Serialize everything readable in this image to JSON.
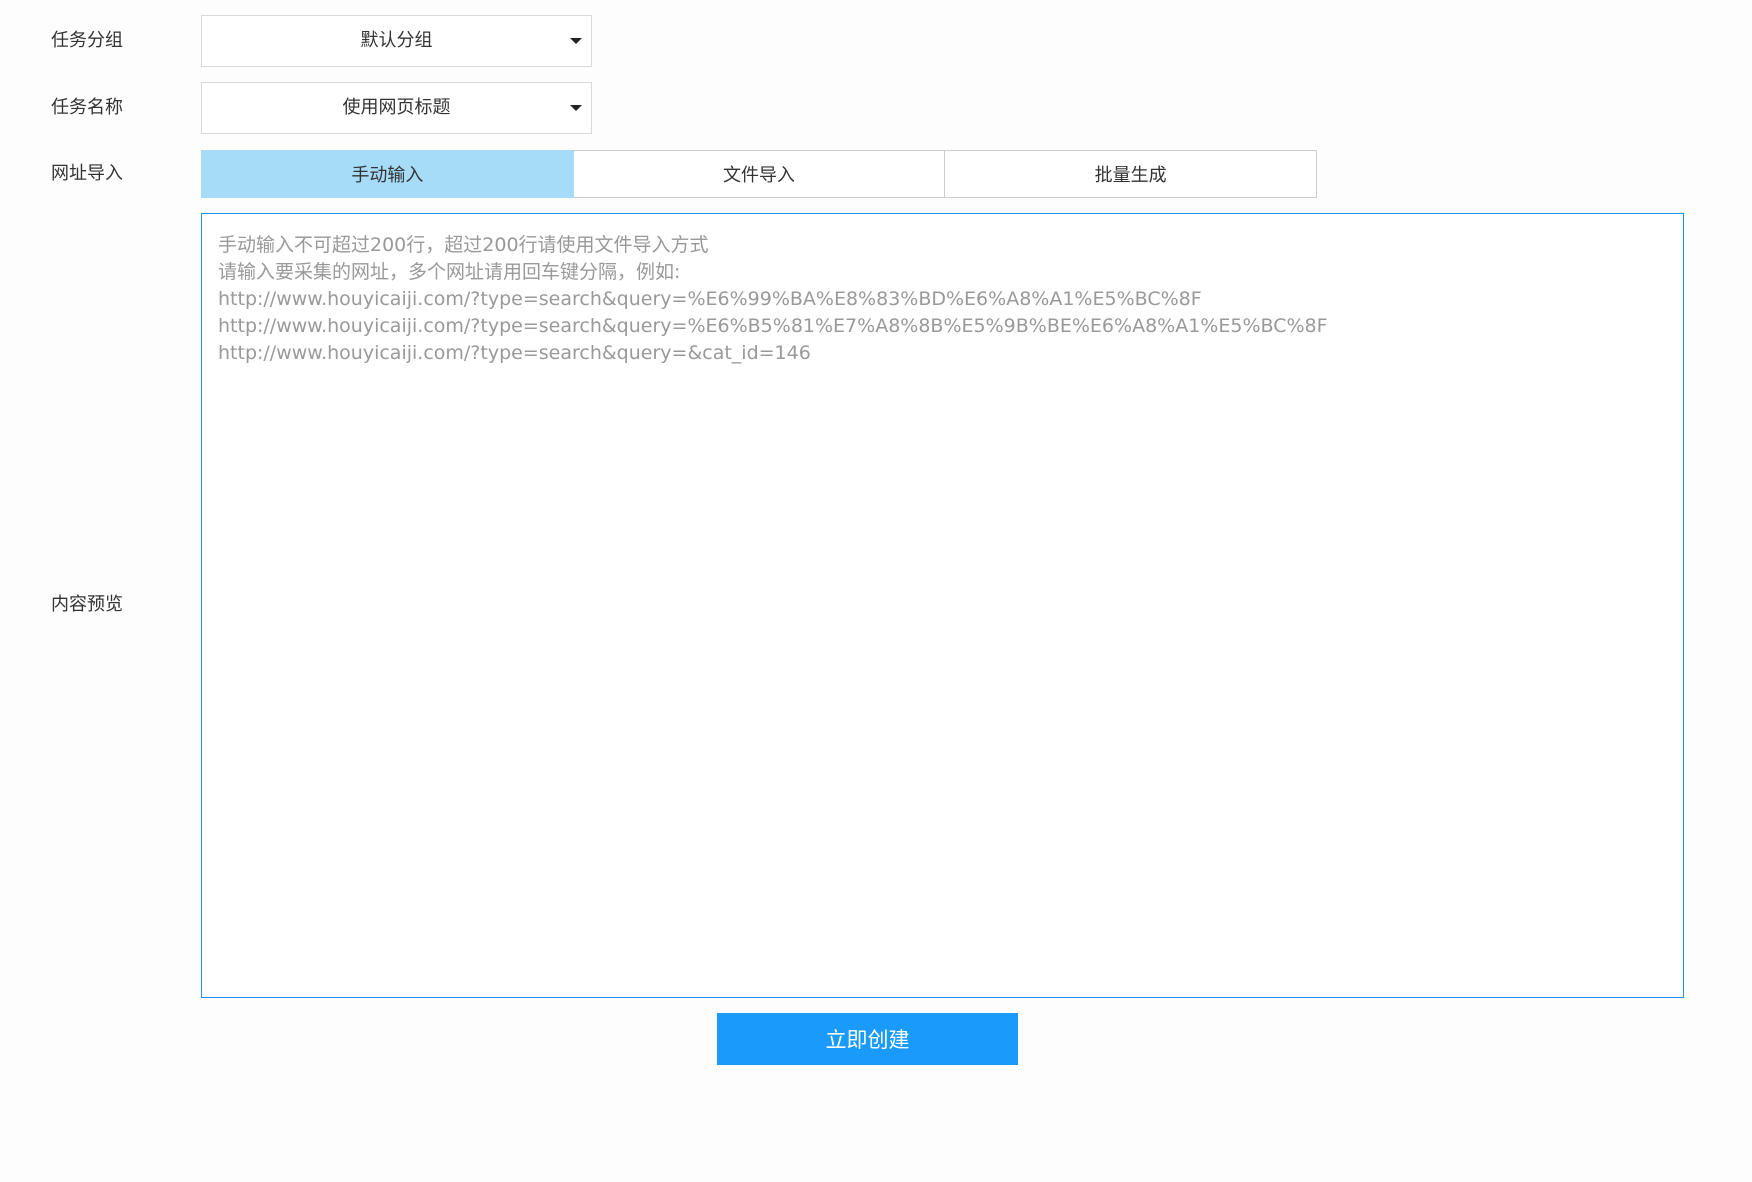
{
  "form": {
    "task_group": {
      "label": "任务分组",
      "value": "默认分组",
      "icon": "caret-down-icon"
    },
    "task_name": {
      "label": "任务名称",
      "value": "使用网页标题",
      "icon": "caret-down-icon"
    },
    "url_import": {
      "label": "网址导入",
      "tabs": [
        {
          "label": "手动输入",
          "active": true
        },
        {
          "label": "文件导入",
          "active": false
        },
        {
          "label": "批量生成",
          "active": false
        }
      ],
      "active_color": "#a6dcf7"
    },
    "content_preview": {
      "label": "内容预览",
      "value": "",
      "placeholder": "手动输入不可超过200行，超过200行请使用文件导入方式\n请输入要采集的网址，多个网址请用回车键分隔，例如:\nhttp://www.houyicaiji.com/?type=search&query=%E6%99%BA%E8%83%BD%E6%A8%A1%E5%BC%8F\nhttp://www.houyicaiji.com/?type=search&query=%E6%B5%81%E7%A8%8B%E5%9B%BE%E6%A8%A1%E5%BC%8F\nhttp://www.houyicaiji.com/?type=search&query=&cat_id=146"
    },
    "submit": {
      "label": "立即创建",
      "color": "#1a9bfc"
    }
  }
}
